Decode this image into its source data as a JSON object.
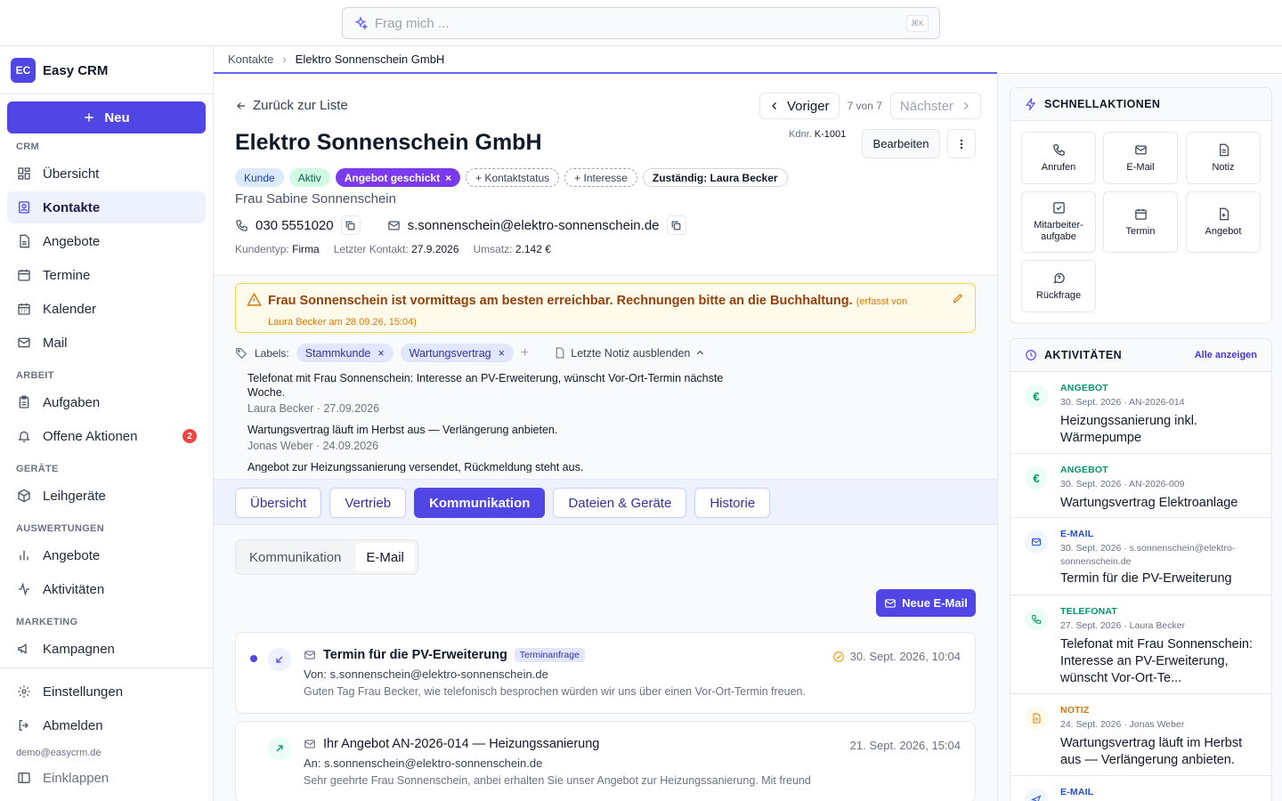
{
  "search": {
    "placeholder": "Frag mich ...",
    "shortcut": "⌘K"
  },
  "app": {
    "logo": "EC",
    "name": "Easy CRM"
  },
  "sidebar": {
    "new_label": "Neu",
    "sections": {
      "crm": "CRM",
      "arbeit": "ARBEIT",
      "geraete": "GERÄTE",
      "auswertungen": "AUSWERTUNGEN",
      "marketing": "MARKETING"
    },
    "items": {
      "uebersicht": "Übersicht",
      "kontakte": "Kontakte",
      "angebote": "Angebote",
      "termine": "Termine",
      "kalender": "Kalender",
      "mail": "Mail",
      "aufgaben": "Aufgaben",
      "offene_aktionen": "Offene Aktionen",
      "leihgeraete": "Leihgeräte",
      "auswertung_angebote": "Angebote",
      "aktivitaeten": "Aktivitäten",
      "kampagnen": "Kampagnen",
      "einstellungen": "Einstellungen",
      "abmelden": "Abmelden",
      "einklappen": "Einklappen"
    },
    "offene_aktionen_count": "2",
    "user_email": "demo@easycrm.de"
  },
  "breadcrumb": {
    "parent": "Kontakte",
    "current": "Elektro Sonnenschein GmbH"
  },
  "header": {
    "back": "Zurück zur Liste",
    "prev": "Voriger",
    "position": "7 von 7",
    "next": "Nächster",
    "title": "Elektro Sonnenschein GmbH",
    "kdnr_label": "Kdnr.",
    "kdnr": "K-1001",
    "edit": "Bearbeiten",
    "tags": {
      "kunde": "Kunde",
      "aktiv": "Aktiv",
      "angebot": "Angebot geschickt",
      "kontaktstatus": "+ Kontaktstatus",
      "interesse": "+ Interesse",
      "owner": "Zuständig: Laura Becker"
    },
    "person": "Frau Sabine Sonnenschein",
    "phone": "030 5551020",
    "email": "s.sonnenschein@elektro-sonnenschein.de",
    "meta": {
      "type_label": "Kundentyp:",
      "type": "Firma",
      "last_label": "Letzter Kontakt:",
      "last": "27.9.2026",
      "revenue_label": "Umsatz:",
      "revenue": "2.142 €"
    }
  },
  "alert": {
    "text": "Frau Sonnenschein ist vormittags am besten erreichbar. Rechnungen bitte an die Buchhaltung.",
    "meta": "(erfasst von Laura Becker am 28.09.26, 15:04)"
  },
  "labels": {
    "title": "Labels:",
    "items": [
      "Stammkunde",
      "Wartungsvertrag"
    ],
    "hide_note": "Letzte Notiz ausblenden"
  },
  "notes": [
    {
      "text": "Telefonat mit Frau Sonnenschein: Interesse an PV-Erweiterung, wünscht Vor-Ort-Termin nächste Woche.",
      "who": "Laura Becker · 27.09.2026"
    },
    {
      "text": "Wartungsvertrag läuft im Herbst aus — Verlängerung anbieten.",
      "who": "Jonas Weber · 24.09.2026"
    },
    {
      "text": "Angebot zur Heizungssanierung versendet, Rückmeldung steht aus.",
      "who": ""
    }
  ],
  "tabs": [
    "Übersicht",
    "Vertrieb",
    "Kommunikation",
    "Dateien & Geräte",
    "Historie"
  ],
  "subtabs": [
    "Kommunikation",
    "E-Mail"
  ],
  "new_mail": "Neue E-Mail",
  "mails": [
    {
      "subject": "Termin für die PV-Erweiterung",
      "tag": "Terminanfrage",
      "from": "Von: s.sonnenschein@elektro-sonnenschein.de",
      "preview": "Guten Tag Frau Becker, wie telefonisch besprochen würden wir uns über einen Vor-Ort-Termin freuen.",
      "date": "30. Sept. 2026, 10:04"
    },
    {
      "subject": "Ihr Angebot AN-2026-014 — Heizungssanierung",
      "from": "An: s.sonnenschein@elektro-sonnenschein.de",
      "preview": "Sehr geehrte Frau Sonnenschein, anbei erhalten Sie unser Angebot zur Heizungssanierung. Mit freund",
      "date": "21. Sept. 2026, 15:04"
    }
  ],
  "quick_actions": {
    "title": "SCHNELLAKTIONEN",
    "items": [
      "Anrufen",
      "E-Mail",
      "Notiz",
      "Mitarbeiter-aufgabe",
      "Termin",
      "Angebot",
      "Rückfrage"
    ]
  },
  "activities": {
    "title": "AKTIVITÄTEN",
    "all": "Alle anzeigen",
    "items": [
      {
        "type": "ANGEBOT",
        "meta": "30. Sept. 2026 · AN-2026-014",
        "text": "Heizungssanierung inkl. Wärmepumpe",
        "color": "#059669",
        "icon": "euro-icon"
      },
      {
        "type": "ANGEBOT",
        "meta": "30. Sept. 2026 · AN-2026-009",
        "text": "Wartungsvertrag Elektroanlage",
        "color": "#059669",
        "icon": "euro-icon"
      },
      {
        "type": "E-MAIL",
        "meta": "30. Sept. 2026 · s.sonnenschein@elektro-sonnenschein.de",
        "text": "Termin für die PV-Erweiterung",
        "color": "#1d4ed8",
        "icon": "mail-icon"
      },
      {
        "type": "TELEFONAT",
        "meta": "27. Sept. 2026 · Laura Becker",
        "text": "Telefonat mit Frau Sonnenschein: Interesse an PV-Erweiterung, wünscht Vor-Ort-Te...",
        "color": "#059669",
        "icon": "phone-icon"
      },
      {
        "type": "NOTIZ",
        "meta": "24. Sept. 2026 · Jonas Weber",
        "text": "Wartungsvertrag läuft im Herbst aus — Verlängerung anbieten.",
        "color": "#d97706",
        "icon": "note-icon"
      },
      {
        "type": "E-MAIL",
        "meta": "",
        "text": "",
        "color": "#1d4ed8",
        "icon": "send-icon"
      }
    ]
  },
  "colors": {
    "accent": "#4f46e5",
    "alert_bg": "#fffbeb",
    "alert_text": "#92400e",
    "badge": "#ef4444"
  }
}
